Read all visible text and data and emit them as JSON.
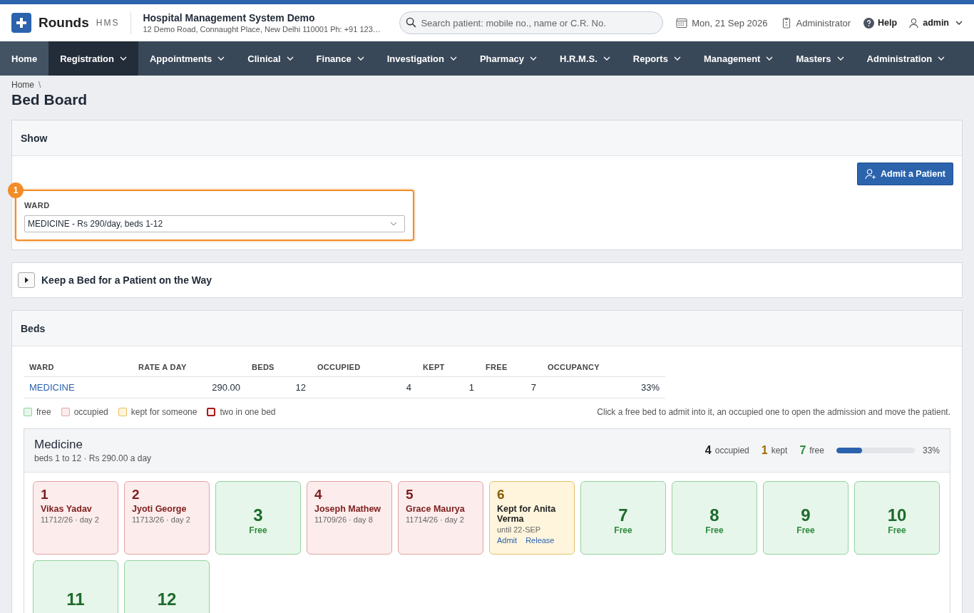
{
  "header": {
    "logo_name": "Rounds",
    "logo_suffix": "HMS",
    "org_name": "Hospital Management System Demo",
    "org_address": "12 Demo Road, Connaught Place, New Delhi 110001 Ph: +91 123…",
    "search": {
      "placeholder": "Search patient: mobile no., name or C.R. No."
    },
    "date": "Mon, 21 Sep 2026",
    "role": "Administrator",
    "help": "Help",
    "user": "admin"
  },
  "nav": [
    {
      "label": "Home",
      "dropdown": false,
      "selected": false
    },
    {
      "label": "Registration",
      "dropdown": true,
      "selected": true
    },
    {
      "label": "Appointments",
      "dropdown": true,
      "selected": false
    },
    {
      "label": "Clinical",
      "dropdown": true,
      "selected": false
    },
    {
      "label": "Finance",
      "dropdown": true,
      "selected": false
    },
    {
      "label": "Investigation",
      "dropdown": true,
      "selected": false
    },
    {
      "label": "Pharmacy",
      "dropdown": true,
      "selected": false
    },
    {
      "label": "H.R.M.S.",
      "dropdown": true,
      "selected": false
    },
    {
      "label": "Reports",
      "dropdown": true,
      "selected": false
    },
    {
      "label": "Management",
      "dropdown": true,
      "selected": false
    },
    {
      "label": "Masters",
      "dropdown": true,
      "selected": false
    },
    {
      "label": "Administration",
      "dropdown": true,
      "selected": false
    }
  ],
  "breadcrumb": {
    "items": [
      "Home"
    ],
    "separator": "\\"
  },
  "title": "Bed Board",
  "show_panel": {
    "title": "Show",
    "admit_button": "Admit a Patient",
    "step": "1",
    "highlighted": true,
    "ward_label": "WARD",
    "ward_value": "MEDICINE - Rs 290/day, beds 1-12"
  },
  "keep_panel": {
    "title": "Keep a Bed for a Patient on the Way",
    "expanded": false
  },
  "beds_panel": {
    "title": "Beds",
    "table": {
      "columns": [
        "WARD",
        "RATE A DAY",
        "BEDS",
        "OCCUPIED",
        "KEPT",
        "FREE",
        "OCCUPANCY"
      ],
      "rows": [
        [
          "MEDICINE",
          "290.00",
          "12",
          "4",
          "1",
          "7",
          "33%"
        ]
      ]
    },
    "legend": [
      {
        "label": "free",
        "kind": "free"
      },
      {
        "label": "occupied",
        "kind": "occupied"
      },
      {
        "label": "kept for someone",
        "kind": "kept"
      },
      {
        "label": "two in one bed",
        "kind": "double"
      }
    ],
    "hint": "Click a free bed to admit into it, an occupied one to open the admission and move the patient.",
    "wards": [
      {
        "name": "Medicine",
        "subtitle": "beds 1 to 12 · Rs 290.00 a day",
        "occupied_count": "4",
        "occupied_label": "occupied",
        "kept_count": "1",
        "kept_label": "kept",
        "free_count": "7",
        "free_label": "free",
        "level": 0.33,
        "percent": "33%",
        "beds": [
          {
            "number": "1",
            "kind": "occupied",
            "name": "Vikas Yadav",
            "detail": "11712/26 · day 2"
          },
          {
            "number": "2",
            "kind": "occupied",
            "name": "Jyoti George",
            "detail": "11713/26 · day 2"
          },
          {
            "number": "3",
            "kind": "free",
            "label": "Free"
          },
          {
            "number": "4",
            "kind": "occupied",
            "name": "Joseph Mathew",
            "detail": "11709/26 · day 8"
          },
          {
            "number": "5",
            "kind": "occupied",
            "name": "Grace Maurya",
            "detail": "11714/26 · day 2"
          },
          {
            "number": "6",
            "kind": "kept",
            "name": "Kept for Anita Verma",
            "detail": "until 22-SEP",
            "actions": [
              "Admit",
              "Release"
            ]
          },
          {
            "number": "7",
            "kind": "free",
            "label": "Free"
          },
          {
            "number": "8",
            "kind": "free",
            "label": "Free"
          },
          {
            "number": "9",
            "kind": "free",
            "label": "Free"
          },
          {
            "number": "10",
            "kind": "free",
            "label": "Free"
          },
          {
            "number": "11",
            "kind": "free"
          },
          {
            "number": "12",
            "kind": "free"
          }
        ]
      }
    ]
  }
}
